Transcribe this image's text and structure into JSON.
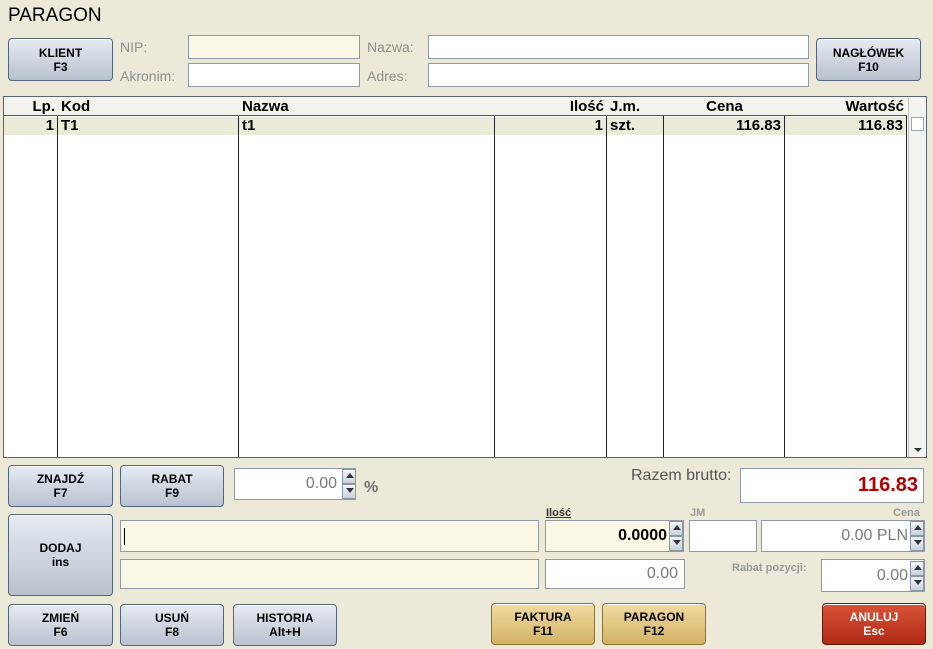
{
  "window": {
    "title": "PARAGON"
  },
  "header": {
    "klient_label": "KLIENT",
    "klient_key": "F3",
    "naglowek_label": "NAGŁÓWEK",
    "naglowek_key": "F10",
    "nip_label": "NIP:",
    "nip_value": "",
    "akronim_label": "Akronim:",
    "akronim_value": "",
    "nazwa_label": "Nazwa:",
    "nazwa_value": "",
    "adres_label": "Adres:",
    "adres_value": ""
  },
  "table": {
    "columns": [
      "Lp.",
      "Kod",
      "Nazwa",
      "Ilość",
      "J.m.",
      "Cena",
      "Wartość"
    ],
    "rows": [
      {
        "lp": "1",
        "kod": "T1",
        "nazwa": "t1",
        "ilosc": "1",
        "jm": "szt.",
        "cena": "116.83",
        "wartosc": "116.83"
      }
    ]
  },
  "actions": {
    "znajdz_label": "ZNAJDŹ",
    "znajdz_key": "F7",
    "rabat_label": "RABAT",
    "rabat_key": "F9",
    "rabat_value": "0.00",
    "percent_sign": "%",
    "razem_label": "Razem brutto:",
    "razem_value": "116.83",
    "dodaj_label": "DODAJ",
    "dodaj_key": "ins",
    "zmien_label": "ZMIEŃ",
    "zmien_key": "F6",
    "usun_label": "USUŃ",
    "usun_key": "F8",
    "historia_label": "HISTORIA",
    "historia_key": "Alt+H",
    "faktura_label": "FAKTURA",
    "faktura_key": "F11",
    "paragon_label": "PARAGON",
    "paragon_key": "F12",
    "anuluj_label": "ANULUJ",
    "anuluj_key": "Esc"
  },
  "entry": {
    "ilosc_label": "Ilość",
    "ilosc_value": "0.0000",
    "jm_label": "JM",
    "jm_value": "",
    "cena_label": "Cena",
    "cena_value": "0.00 PLN",
    "second_value": "0.00",
    "rabat_pozycji_label": "Rabat pozycji:",
    "rabat_pozycji_value": "0.00"
  },
  "colors": {
    "background": "#ece9d8",
    "total_red": "#b30000",
    "row_highlight": "#ecead9",
    "input_cream": "#fcf8e6"
  }
}
